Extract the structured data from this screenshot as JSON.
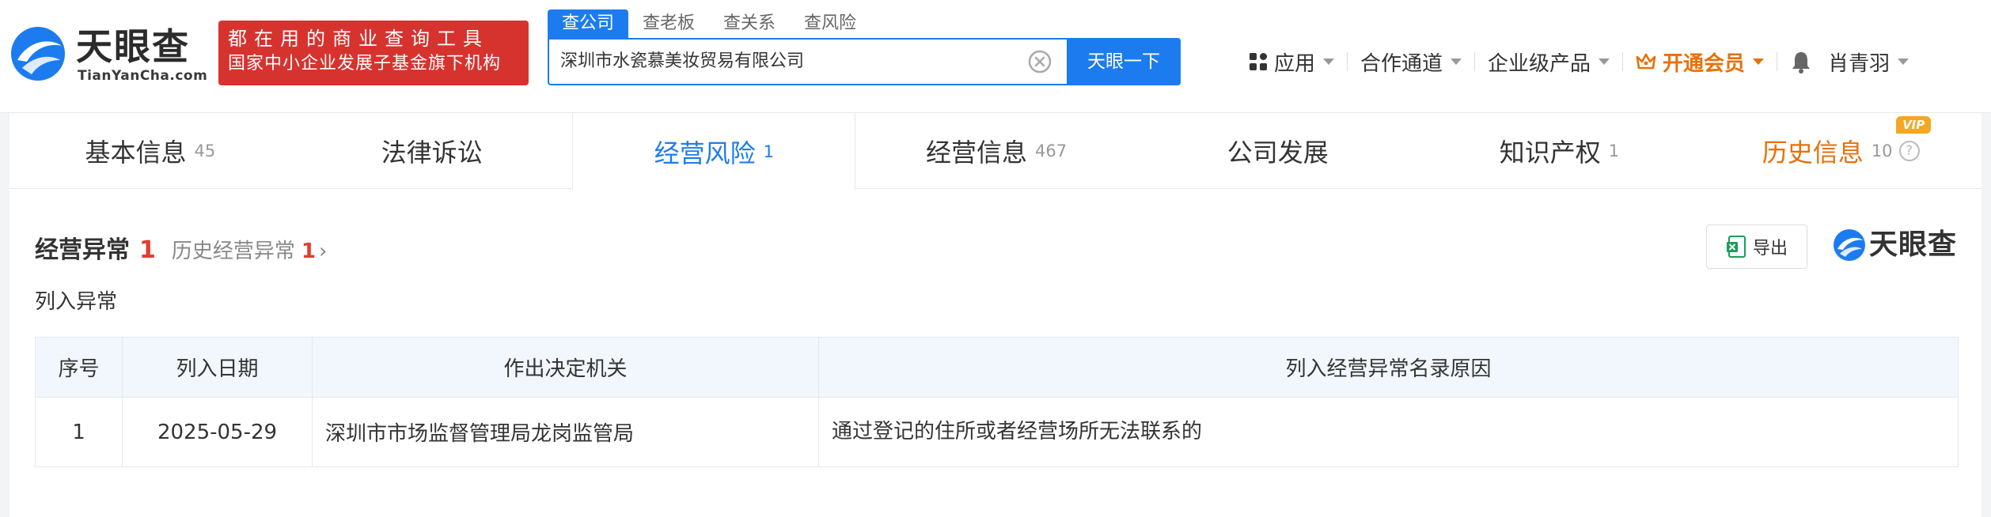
{
  "header": {
    "logo_text": "天眼查",
    "logo_sub": "TianYanCha.com",
    "slogan_line1": "都在用的商业查询工具",
    "slogan_line2": "国家中小企业发展子基金旗下机构",
    "search_tabs": [
      {
        "label": "查公司",
        "active": true
      },
      {
        "label": "查老板",
        "active": false
      },
      {
        "label": "查关系",
        "active": false
      },
      {
        "label": "查风险",
        "active": false
      }
    ],
    "search_value": "深圳市水瓷慕美妆贸易有限公司",
    "search_button": "天眼一下",
    "nav": {
      "apps": "应用",
      "partner": "合作通道",
      "enterprise": "企业级产品",
      "vip": "开通会员",
      "user": "肖青羽"
    }
  },
  "tabs": [
    {
      "label": "基本信息",
      "count": "45"
    },
    {
      "label": "法律诉讼",
      "count": ""
    },
    {
      "label": "经营风险",
      "count": "1"
    },
    {
      "label": "经营信息",
      "count": "467"
    },
    {
      "label": "公司发展",
      "count": ""
    },
    {
      "label": "知识产权",
      "count": "1"
    },
    {
      "label": "历史信息",
      "count": "10"
    }
  ],
  "vip_badge": "VIP",
  "section": {
    "title": "经营异常",
    "count": "1",
    "history_label": "历史经营异常",
    "history_count": "1",
    "export_label": "导出",
    "brand": "天眼查",
    "sub_label": "列入异常"
  },
  "table": {
    "headers": [
      "序号",
      "列入日期",
      "作出决定机关",
      "列入经营异常名录原因"
    ],
    "rows": [
      [
        "1",
        "2025-05-29",
        "深圳市市场监督管理局龙岗监管局",
        "通过登记的住所或者经营场所无法联系的"
      ]
    ]
  },
  "colors": {
    "accent": "#1c7cef",
    "slogan_bg": "#d6332f",
    "vip": "#e8700a",
    "count_red": "#e33c30"
  }
}
